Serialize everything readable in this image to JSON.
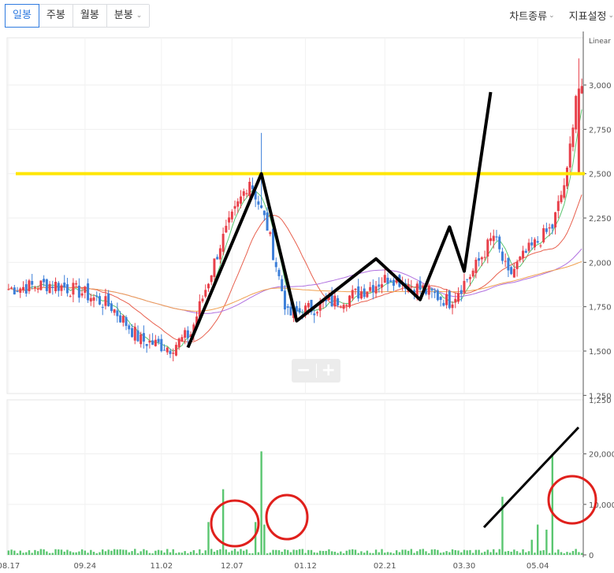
{
  "toolbar": {
    "tabs": [
      {
        "label": "일봉",
        "active": true
      },
      {
        "label": "주봉",
        "active": false
      },
      {
        "label": "월봉",
        "active": false
      },
      {
        "label": "분봉",
        "active": false,
        "dropdown": true
      }
    ],
    "chart_type_label": "차트종류",
    "indicator_label": "지표설정"
  },
  "zoom": {
    "minus": "−",
    "plus": "+"
  },
  "colors": {
    "up": "#e8404a",
    "down": "#3d7fd9",
    "volume": "#5ac670",
    "ma5": "#5ac670",
    "ma20": "#e8604e",
    "ma60": "#b070e0",
    "ma120": "#f0a050",
    "accent": "#2f7be0",
    "highlight_line": "#ffe600",
    "annotation_circle": "#e0201c",
    "annotation_line": "#000000"
  },
  "chart_data": {
    "type": "candlestick",
    "price_scale_label": "Linear",
    "price_axis": {
      "ticks": [
        "3,000",
        "2,750",
        "2,500",
        "2,250",
        "2,000",
        "1,750",
        "1,500",
        "1,250"
      ],
      "ylim": [
        1250,
        3100
      ]
    },
    "volume_axis": {
      "ticks": [
        "20,000,",
        "10,000,",
        "0"
      ]
    },
    "x_axis": {
      "ticks": [
        "08.17",
        "09.24",
        "11.02",
        "12.07",
        "01.12",
        "02.21",
        "03.30",
        "05.04"
      ]
    },
    "price_path_keypoints": [
      [
        0,
        1850
      ],
      [
        15,
        1880
      ],
      [
        25,
        1830
      ],
      [
        35,
        1750
      ],
      [
        45,
        1560
      ],
      [
        55,
        1520
      ],
      [
        62,
        1600
      ],
      [
        72,
        2100
      ],
      [
        82,
        2470
      ],
      [
        88,
        2200
      ],
      [
        95,
        1700
      ],
      [
        105,
        1750
      ],
      [
        118,
        1820
      ],
      [
        130,
        1920
      ],
      [
        140,
        1850
      ],
      [
        150,
        1780
      ],
      [
        158,
        1950
      ],
      [
        165,
        2150
      ],
      [
        170,
        1920
      ],
      [
        176,
        2050
      ],
      [
        185,
        2200
      ],
      [
        190,
        2500
      ],
      [
        193,
        2950
      ]
    ],
    "volume_spikes": [
      [
        68,
        6500
      ],
      [
        73,
        13000
      ],
      [
        84,
        6500
      ],
      [
        86,
        20500
      ],
      [
        87,
        6000
      ],
      [
        168,
        11500
      ],
      [
        178,
        3000
      ],
      [
        180,
        6000
      ],
      [
        183,
        5000
      ],
      [
        185,
        20000
      ]
    ],
    "annotations": {
      "support_resistance_price": 2500,
      "zigzag_prices": [
        [
          61,
          1520
        ],
        [
          86,
          2500
        ],
        [
          98,
          1670
        ],
        [
          125,
          2020
        ],
        [
          140,
          1790
        ],
        [
          150,
          2200
        ],
        [
          155,
          1950
        ],
        [
          164,
          2960
        ]
      ]
    }
  }
}
